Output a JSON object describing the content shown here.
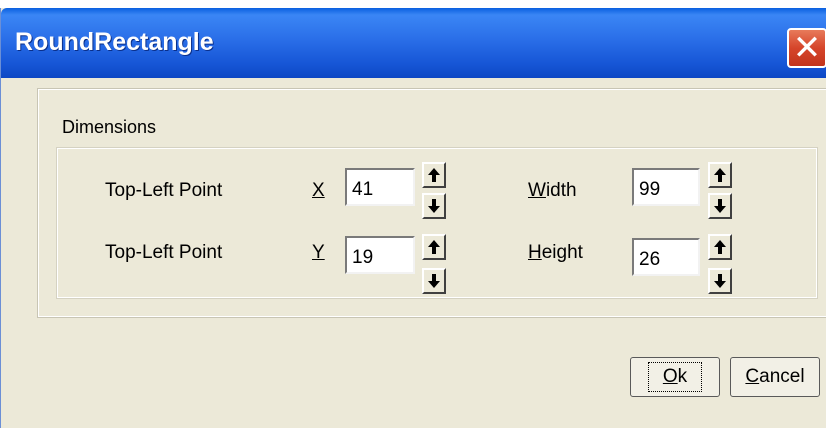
{
  "window": {
    "title": "RoundRectangle",
    "close_icon": "close-icon"
  },
  "dimensions": {
    "label": "Dimensions",
    "rows": [
      {
        "point_label": "Top-Left Point",
        "axis_key": "X",
        "axis_value": "41",
        "size_key": "W",
        "size_rest": "idth",
        "size_value": "99"
      },
      {
        "point_label": "Top-Left Point",
        "axis_key": "Y",
        "axis_value": "19",
        "size_key": "H",
        "size_rest": "eight",
        "size_value": "26"
      }
    ]
  },
  "buttons": {
    "ok_key": "O",
    "ok_rest": "k",
    "cancel_key": "C",
    "cancel_rest": "ancel"
  },
  "colors": {
    "titlebar": "#2a6ee8",
    "dialog_bg": "#ece9d8",
    "close_red": "#d6452a"
  }
}
